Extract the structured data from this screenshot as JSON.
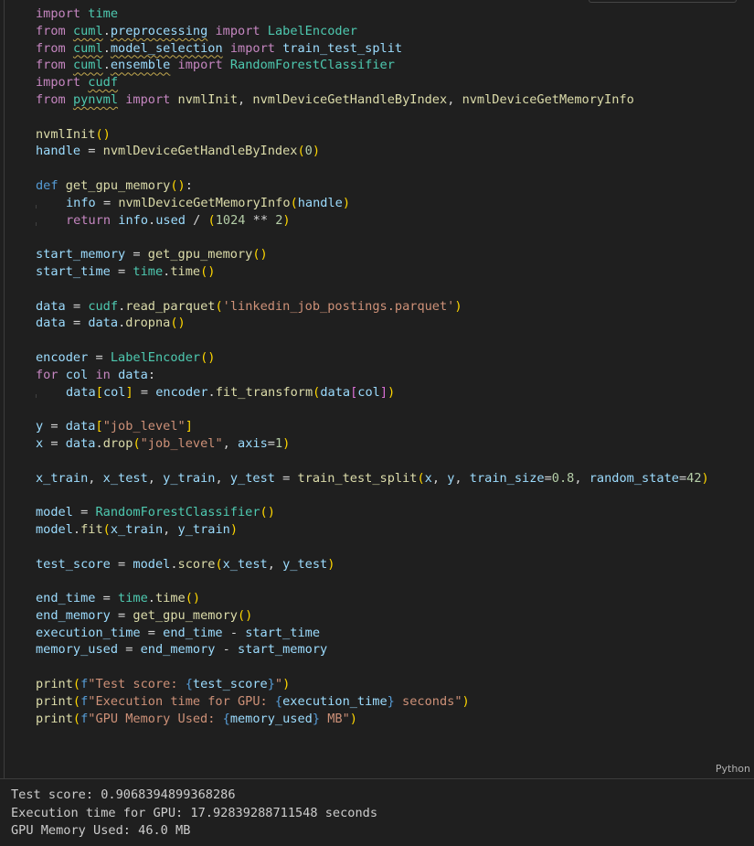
{
  "cell": {
    "language_label": "Python",
    "code_lines": [
      "import time",
      "from cuml.preprocessing import LabelEncoder",
      "from cuml.model_selection import train_test_split",
      "from cuml.ensemble import RandomForestClassifier",
      "import cudf",
      "from pynvml import nvmlInit, nvmlDeviceGetHandleByIndex, nvmlDeviceGetMemoryInfo",
      "",
      "nvmlInit()",
      "handle = nvmlDeviceGetHandleByIndex(0)",
      "",
      "def get_gpu_memory():",
      "    info = nvmlDeviceGetMemoryInfo(handle)",
      "    return info.used / (1024 ** 2)",
      "",
      "start_memory = get_gpu_memory()",
      "start_time = time.time()",
      "",
      "data = cudf.read_parquet('linkedin_job_postings.parquet')",
      "data = data.dropna()",
      "",
      "encoder = LabelEncoder()",
      "for col in data:",
      "    data[col] = encoder.fit_transform(data[col])",
      "",
      "y = data[\"job_level\"]",
      "x = data.drop(\"job_level\", axis=1)",
      "",
      "x_train, x_test, y_train, y_test = train_test_split(x, y, train_size=0.8, random_state=42)",
      "",
      "model = RandomForestClassifier()",
      "model.fit(x_train, y_train)",
      "",
      "test_score = model.score(x_test, y_test)",
      "",
      "end_time = time.time()",
      "end_memory = get_gpu_memory()",
      "execution_time = end_time - start_time",
      "memory_used = end_memory - start_memory",
      "",
      "print(f\"Test score: {test_score}\")",
      "print(f\"Execution time for GPU: {execution_time} seconds\")",
      "print(f\"GPU Memory Used: {memory_used} MB\")"
    ]
  },
  "output": {
    "lines": [
      "Test score: 0.9068394899368286",
      "Execution time for GPU: 17.92839288711548 seconds",
      "GPU Memory Used: 46.0 MB"
    ]
  },
  "colors": {
    "background": "#1f1f1f",
    "keyword": "#c586c0",
    "def_keyword": "#569cd6",
    "module": "#4ec9b0",
    "variable": "#9cdcfe",
    "function": "#dcdcaa",
    "number": "#b5cea8",
    "string": "#ce9178",
    "bracket_1": "#ffd700",
    "bracket_2": "#da70d6",
    "bracket_3": "#179fff",
    "squiggle_warning": "#c2a84f"
  }
}
